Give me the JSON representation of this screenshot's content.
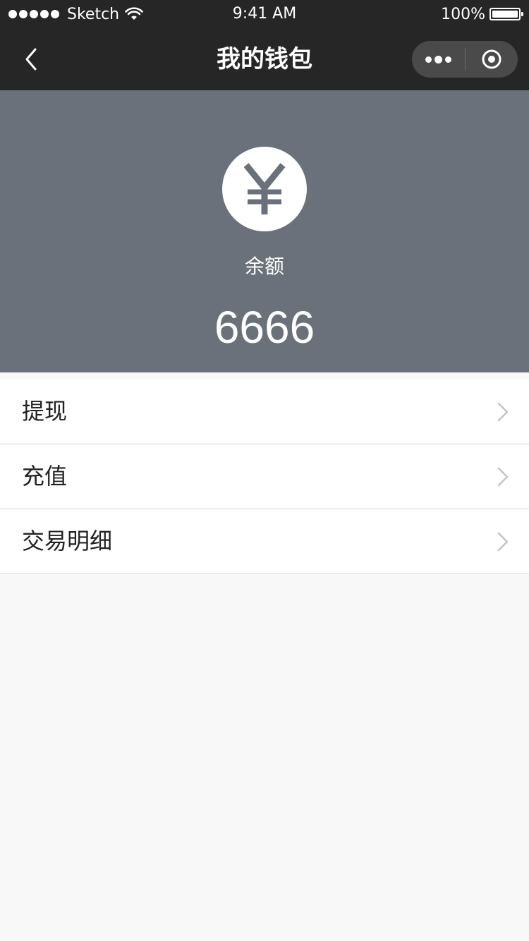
{
  "status_bar": {
    "carrier": "Sketch",
    "time": "9:41 AM",
    "battery_percent": "100%",
    "battery_level": 1.0,
    "signal_bars": 5
  },
  "nav": {
    "title": "我的钱包",
    "back_icon": "chevron-left-icon",
    "more_icon": "more-dots-icon",
    "close_icon": "target-circle-icon"
  },
  "wallet": {
    "icon": "yen-icon",
    "balance_label": "余额",
    "balance_value": "6666"
  },
  "menu": {
    "items": [
      {
        "label": "提现",
        "icon": "chevron-right-icon"
      },
      {
        "label": "充值",
        "icon": "chevron-right-icon"
      },
      {
        "label": "交易明细",
        "icon": "chevron-right-icon"
      }
    ]
  },
  "colors": {
    "bar_background": "#262626",
    "header_background": "#6a717b",
    "page_background": "#f8f8f8",
    "text_primary": "#222222"
  }
}
